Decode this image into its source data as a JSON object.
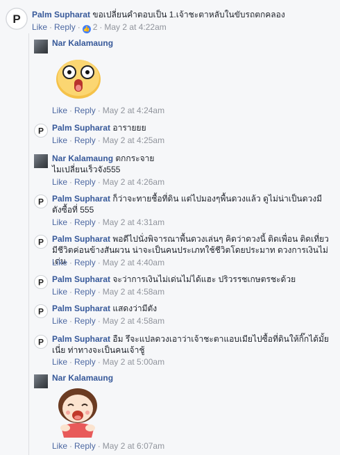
{
  "actions": {
    "like": "Like",
    "reply": "Reply",
    "separator": "·"
  },
  "comments": [
    {
      "author": "Palm Supharat",
      "text": "ขอเปลี่ยนคำตอบเป็น 1.เจ้าชะตาหลับในขับรถตกคลอง",
      "time": "May 2 at 4:22am",
      "reactions": "2"
    },
    {
      "author": "Nar Kalamaung",
      "text": "",
      "time": "May 2 at 4:24am"
    },
    {
      "author": "Palm Supharat",
      "text": "อารายยย",
      "time": "May 2 at 4:25am"
    },
    {
      "author": "Nar Kalamaung",
      "text": "ตกกระจาย",
      "text2": "ไมเปลี่ยนเร็วจัง555",
      "time": "May 2 at 4:26am"
    },
    {
      "author": "Palm Supharat",
      "text": "ก็ว่าจะทายชื้อที่ดิน แต่ไปมองๆพื้นดวงแล้ว ดูไม่น่าเป็นดวงมี",
      "text2": "ตังซื้อที่ 555",
      "time": "May 2 at 4:31am"
    },
    {
      "author": "Palm Supharat",
      "text": "พอดีไปนั่งพิจารณาพื้นดวงเล่นๆ คิดว่าดวงนี้ ติดเพื่อน ติดเที่ยว",
      "text2": "มีชีวิตค่อนข้างสันผวน น่าจะเป็นคนประเภทใช้ชีวิตโดยประมาท ดวงการเงินไม่เด่น",
      "time": "May 2 at 4:40am"
    },
    {
      "author": "Palm Supharat",
      "text": "จะว่าการเงินไม่เด่นไม่ได้แฮะ ปริวรรชเกษตรชะด้วย",
      "time": "May 2 at 4:58am"
    },
    {
      "author": "Palm Supharat",
      "text": "แสดงว่ามีตัง",
      "time": "May 2 at 4:58am"
    },
    {
      "author": "Palm Supharat",
      "text": "อืม รึจะแปลดวงเอาว่าเจ้าชะตาแอบเมียไปซื้อที่ดินให้กิ๊กได้มั้ย",
      "text2": "เนี่ย ท่าทางจะเป็นคนเจ้าชู้",
      "time": "May 2 at 5:00am"
    },
    {
      "author": "Nar Kalamaung",
      "text": "",
      "time": "May 2 at 6:07am"
    }
  ],
  "colors": {
    "author": "#365899",
    "link": "#4b67a1",
    "meta": "#90949c",
    "reaction": "#4080ff"
  },
  "icons": [
    "palm-avatar-icon",
    "nar-avatar-icon",
    "like-reaction-icon",
    "surprised-emoji-sticker",
    "laughing-girl-sticker"
  ]
}
